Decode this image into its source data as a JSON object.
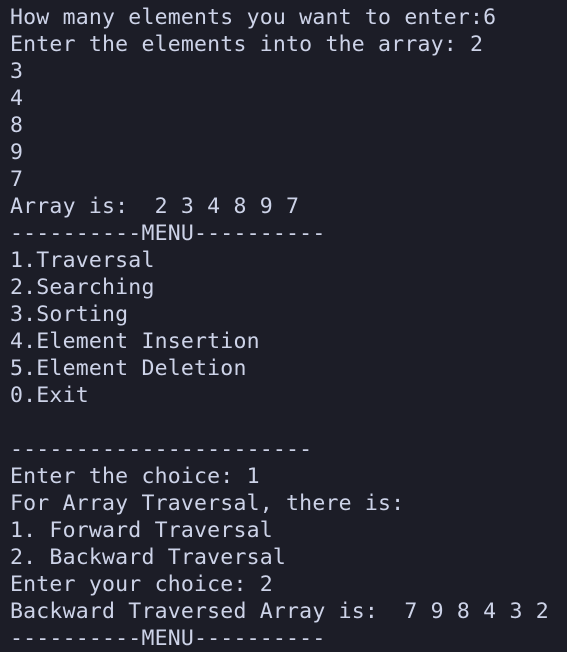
{
  "terminal": {
    "lines": [
      "How many elements you want to enter:6",
      "Enter the elements into the array: 2",
      "3",
      "4",
      "8",
      "9",
      "7",
      "Array is:  2 3 4 8 9 7",
      "----------MENU----------",
      "1.Traversal",
      "2.Searching",
      "3.Sorting",
      "4.Element Insertion",
      "5.Element Deletion",
      "0.Exit",
      "",
      "-----------------------",
      "Enter the choice: 1",
      "For Array Traversal, there is:",
      "1. Forward Traversal",
      "2. Backward Traversal",
      "Enter your choice: 2",
      "Backward Traversed Array is:  7 9 8 4 3 2",
      "----------MENU----------"
    ]
  }
}
